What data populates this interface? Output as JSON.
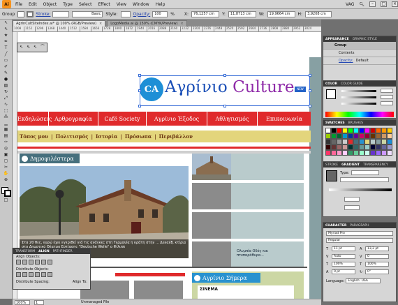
{
  "app": {
    "logo": "Ai",
    "menu": [
      "File",
      "Edit",
      "Object",
      "Type",
      "Select",
      "Effect",
      "View",
      "Window",
      "Help"
    ],
    "workspace": "VAG",
    "search_icon": "search-icon"
  },
  "control_bar": {
    "selection_label": "Group",
    "stroke_label": "Stroke:",
    "basic_label": "Basic",
    "style_label": "Style:",
    "opacity_label": "Opacity:",
    "opacity_value": "100",
    "opacity_unit": "%",
    "x_label": "X:",
    "x_value": "76,1257 cm",
    "y_label": "Y:",
    "y_value": "11,8713 cm",
    "w_label": "W:",
    "w_value": "19,9664 cm",
    "h_label": "H:",
    "h_value": "3,9208 cm"
  },
  "doc_tabs": [
    {
      "title": "AgrinCultSiteIndex.ai* @ 100% (RGB/Preview)",
      "active": true
    },
    {
      "title": "LogoMedia.ai @ 150% (CMYK/Preview)",
      "active": false
    }
  ],
  "ruler_ticks": [
    "1008",
    "1152",
    "1296",
    "1368",
    "1440",
    "1512",
    "1584",
    "1656",
    "1728",
    "1800",
    "1872",
    "1944",
    "2016",
    "2088",
    "2160",
    "2232",
    "2304",
    "2376",
    "2448",
    "2520",
    "2592",
    "2664",
    "2736",
    "2808",
    "2880",
    "2952",
    "3024"
  ],
  "site": {
    "logo_mark": "CA",
    "logo_word_a": "Αγρίνιο",
    "logo_word_b": "Culture",
    "logo_badge": "NEW",
    "nav": [
      "Εκδηλώσεις",
      "Αρθρογραφία",
      "Café Society",
      "Αγρίνιο Έξοδος",
      "Αθλητισμός",
      "Επικοινωνία"
    ],
    "subnav": [
      "Τόπος μου",
      "Πολιτισμός",
      "Ιστορία",
      "Πρόσωπα",
      "Περιβάλλον"
    ],
    "subnav_sep": "|",
    "popular_title": "Δημοφιλέστερα",
    "caption": "Στα 20 θες, ευρώ έχει εγκριθεί γιά τις ανάγκες στη Γερμανία η κράτη στην ... Δεκαέξι κτίρια στο Δημοτικό Θέατρο Εστίασης \"Deutsche Welle\" ο Φίλιππ",
    "thumb_text_1": "Ολυμπία Οδός και",
    "thumb_text_2": "πτυπαράθυρα...",
    "today_title": "Αγρίνιο Σήμερα",
    "cinema_label": "ΣΙΝΕΜΑ"
  },
  "status_bar": {
    "zoom": "100%",
    "page": "1",
    "state": "Unmanaged File"
  },
  "panels": {
    "appearance": {
      "tabs": [
        "APPEARANCE",
        "GRAPHIC STYLE"
      ],
      "group_label": "Group",
      "contents_label": "Contents",
      "opacity_link": "Opacity:",
      "opacity_value": "Default"
    },
    "color": {
      "tabs": [
        "COLOR",
        "COLOR GUIDE"
      ]
    },
    "swatches": {
      "tabs": [
        "SWATCHES",
        "BRUSHES"
      ]
    },
    "stroke": {
      "tabs": [
        "STROKE",
        "GRADIENT",
        "TRANSPARENCY"
      ],
      "type_label": "Type:"
    },
    "character": {
      "tabs": [
        "CHARACTER",
        "PARAGRAPH"
      ],
      "font": "Myriad Pro",
      "style": "Regular",
      "size": "11 pt",
      "leading": "13,2 pt",
      "kerning": "Auto",
      "tracking": "0",
      "hscale": "100%",
      "vscale": "100%",
      "baseline": "0 pt",
      "rotation": "0°",
      "language_label": "Language:",
      "language": "English: USA"
    },
    "align": {
      "tabs": [
        "TRANSFORM",
        "ALIGN",
        "PATHFINDER"
      ],
      "align_objects": "Align Objects:",
      "distribute_objects": "Distribute Objects:",
      "distribute_spacing": "Distribute Spacing:",
      "align_to": "Align To:"
    }
  },
  "colors": {
    "accent_red": "#e02a2c",
    "teal": "#466f7d",
    "blue": "#2992cf",
    "sand": "#e3d57c",
    "logo_blue": "#1b4fb7",
    "logo_purple": "#8e2aa8"
  },
  "swatch_colors": [
    "#ffffff",
    "#000000",
    "#ff0000",
    "#ffff00",
    "#00ff00",
    "#00ffff",
    "#0000ff",
    "#ff00ff",
    "#cc0000",
    "#ff6600",
    "#ff9900",
    "#ffcc00",
    "#99cc00",
    "#009933",
    "#006633",
    "#0099cc",
    "#003399",
    "#660099",
    "#cc0066",
    "#990033",
    "#663300",
    "#996633",
    "#cc9966",
    "#ffcc99",
    "#333333",
    "#666666",
    "#999999",
    "#cccccc",
    "#e02a2c",
    "#466f7d",
    "#2992cf",
    "#e3d57c",
    "#b9cbcc",
    "#87a0a3",
    "#ccd7a4",
    "#1e8fd6",
    "#330000",
    "#663333",
    "#996666",
    "#cc9999",
    "#003333",
    "#336666",
    "#669999",
    "#99cccc",
    "#000033",
    "#333366",
    "#666699",
    "#9999cc",
    "#ff3366",
    "#ff6699",
    "#ff99cc",
    "#ffccff",
    "#339966",
    "#66cc99",
    "#99ffcc",
    "#ccffee",
    "#6633cc",
    "#9966ff",
    "#cc99ff",
    "#eeddff"
  ]
}
